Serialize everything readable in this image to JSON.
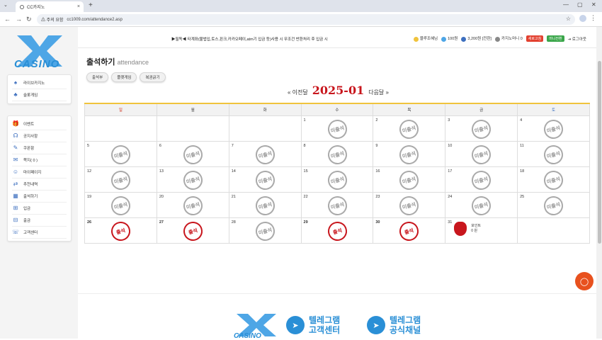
{
  "browser": {
    "tab_title": "CC카지노",
    "url": "cc1009.com/attendance2.asp",
    "security_warning": "주의 요함"
  },
  "sidebar": {
    "logo_text": "CASINO",
    "games": [
      {
        "label": "라이브카지노",
        "icon": "spade-icon"
      },
      {
        "label": "슬롯게임",
        "icon": "club-icon"
      }
    ],
    "menu": [
      {
        "label": "이벤트",
        "icon": "gift-icon"
      },
      {
        "label": "공지사항",
        "icon": "megaphone-icon"
      },
      {
        "label": "쿠폰함",
        "icon": "coupon-icon"
      },
      {
        "label": "쪽지( 0 )",
        "icon": "mail-icon"
      },
      {
        "label": "마이페이지",
        "icon": "user-icon"
      },
      {
        "label": "추천내역",
        "icon": "share-icon"
      },
      {
        "label": "출석하기",
        "icon": "calendar-icon"
      },
      {
        "label": "입금",
        "icon": "deposit-icon"
      },
      {
        "label": "출금",
        "icon": "withdraw-icon"
      },
      {
        "label": "고객센터",
        "icon": "headset-icon"
      }
    ]
  },
  "header": {
    "notice": "▶필독◀ 타계좌(불법입,토스,핀크,카카오페이,atm기 입금 등)사용 시 무조건 반환처리 후 입금 시",
    "user": {
      "name": "블루조혜님",
      "points": "100원",
      "balance": "3,200원 [전환]",
      "casino_money": "카지노머니 0",
      "refresh_label": "새로고침",
      "convert_label": "머니전환",
      "logout_label": "로그아웃"
    }
  },
  "main": {
    "title": "출석하기",
    "subtitle": "attendance",
    "tabs": [
      "출석부",
      "플랫게임",
      "복권긁기"
    ],
    "prev_label": "« 이전달",
    "month": "2025-01",
    "next_label": "다음달 »",
    "weekdays": [
      "일",
      "월",
      "화",
      "수",
      "목",
      "금",
      "토"
    ],
    "absent_label": "미출석",
    "present_label": "출석",
    "weeks": [
      [
        {
          "d": ""
        },
        {
          "d": ""
        },
        {
          "d": ""
        },
        {
          "d": "1",
          "s": "absent"
        },
        {
          "d": "2",
          "s": "absent"
        },
        {
          "d": "3",
          "s": "absent"
        },
        {
          "d": "4",
          "s": "absent"
        }
      ],
      [
        {
          "d": "5",
          "s": "absent"
        },
        {
          "d": "6",
          "s": "absent"
        },
        {
          "d": "7",
          "s": "absent"
        },
        {
          "d": "8",
          "s": "absent"
        },
        {
          "d": "9",
          "s": "absent"
        },
        {
          "d": "10",
          "s": "absent"
        },
        {
          "d": "11",
          "s": "absent"
        }
      ],
      [
        {
          "d": "12",
          "s": "absent"
        },
        {
          "d": "13",
          "s": "absent"
        },
        {
          "d": "14",
          "s": "absent"
        },
        {
          "d": "15",
          "s": "absent"
        },
        {
          "d": "16",
          "s": "absent"
        },
        {
          "d": "17",
          "s": "absent"
        },
        {
          "d": "18",
          "s": "absent"
        }
      ],
      [
        {
          "d": "19",
          "s": "absent"
        },
        {
          "d": "20",
          "s": "absent"
        },
        {
          "d": "21",
          "s": "absent"
        },
        {
          "d": "22",
          "s": "absent"
        },
        {
          "d": "23",
          "s": "absent"
        },
        {
          "d": "24",
          "s": "absent"
        },
        {
          "d": "25",
          "s": "absent"
        }
      ],
      [
        {
          "d": "26",
          "s": "present"
        },
        {
          "d": "27",
          "s": "present"
        },
        {
          "d": "28",
          "s": "absent"
        },
        {
          "d": "29",
          "s": "present"
        },
        {
          "d": "30",
          "s": "present"
        },
        {
          "d": "31",
          "s": "point",
          "t1": "포인트",
          "t2": "0 원"
        },
        {
          "d": ""
        }
      ]
    ]
  },
  "footer": {
    "logo_text": "CASINO",
    "tg_support": [
      "텔레그램",
      "고객센터"
    ],
    "tg_channel": [
      "텔레그램",
      "공식채널"
    ]
  },
  "colors": {
    "accent": "#2a8fd6",
    "month": "#c8161d",
    "chat": "#e8511e"
  }
}
